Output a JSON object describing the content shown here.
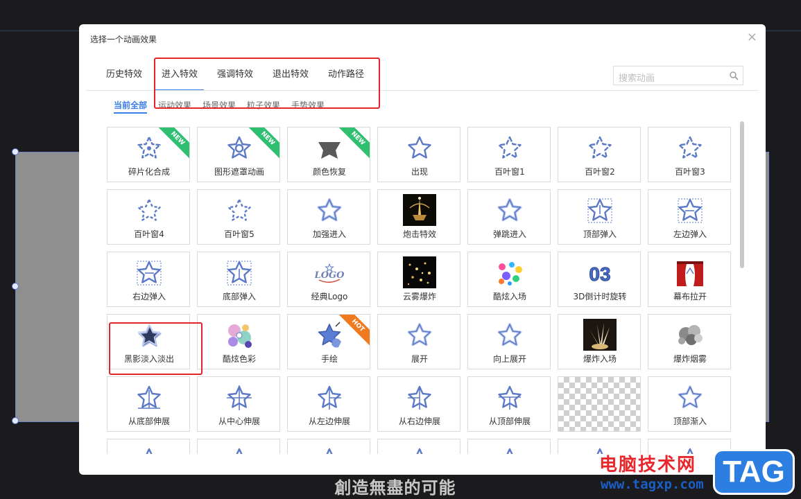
{
  "dialog": {
    "title": "选择一个动画效果",
    "close_label": "×",
    "search_placeholder": "搜索动画"
  },
  "tabs": [
    {
      "label": "历史特效",
      "active": false
    },
    {
      "label": "进入特效",
      "active": true
    },
    {
      "label": "强调特效",
      "active": false
    },
    {
      "label": "退出特效",
      "active": false
    },
    {
      "label": "动作路径",
      "active": false
    }
  ],
  "subtabs": [
    {
      "label": "当前全部",
      "active": true
    },
    {
      "label": "运动效果",
      "active": false
    },
    {
      "label": "场景效果",
      "active": false
    },
    {
      "label": "粒子效果",
      "active": false
    },
    {
      "label": "手势效果",
      "active": false
    }
  ],
  "effects": [
    {
      "label": "碎片化合成",
      "icon": "star-fragment-icon",
      "badge": "NEW"
    },
    {
      "label": "图形遮罩动画",
      "icon": "star-mask-icon",
      "badge": "NEW"
    },
    {
      "label": "颜色恢复",
      "icon": "star-color-icon",
      "badge": "NEW"
    },
    {
      "label": "出现",
      "icon": "star-icon",
      "badge": ""
    },
    {
      "label": "百叶窗1",
      "icon": "star-blinds-icon",
      "badge": ""
    },
    {
      "label": "百叶窗2",
      "icon": "star-blinds-icon",
      "badge": ""
    },
    {
      "label": "百叶窗3",
      "icon": "star-blinds-icon",
      "badge": ""
    },
    {
      "label": "百叶窗4",
      "icon": "star-dashed-icon",
      "badge": ""
    },
    {
      "label": "百叶窗5",
      "icon": "star-dashed-icon",
      "badge": ""
    },
    {
      "label": "加强进入",
      "icon": "star-double-icon",
      "badge": ""
    },
    {
      "label": "炮击特效",
      "icon": "fountain-thumb-icon",
      "badge": ""
    },
    {
      "label": "弹跳进入",
      "icon": "star-double-icon",
      "badge": ""
    },
    {
      "label": "顶部弹入",
      "icon": "star-arrow-down-icon",
      "badge": ""
    },
    {
      "label": "左边弹入",
      "icon": "star-arrow-right-icon",
      "badge": ""
    },
    {
      "label": "右边弹入",
      "icon": "star-arrow-left-icon",
      "badge": ""
    },
    {
      "label": "底部弹入",
      "icon": "star-arrow-up-icon",
      "badge": ""
    },
    {
      "label": "经典Logo",
      "icon": "logo-text-icon",
      "badge": ""
    },
    {
      "label": "云雾爆炸",
      "icon": "sparkle-thumb-icon",
      "badge": ""
    },
    {
      "label": "酷炫入场",
      "icon": "colorful-balls-icon",
      "badge": ""
    },
    {
      "label": "3D倒计时旋转",
      "icon": "3d-number-icon",
      "badge": ""
    },
    {
      "label": "幕布拉开",
      "icon": "curtain-icon",
      "badge": ""
    },
    {
      "label": "黑影淡入淡出",
      "icon": "star-shadow-icon",
      "badge": ""
    },
    {
      "label": "酷炫色彩",
      "icon": "color-blobs-icon",
      "badge": ""
    },
    {
      "label": "手绘",
      "icon": "hand-draw-icon",
      "badge": "HOT"
    },
    {
      "label": "展开",
      "icon": "star-expand-icon",
      "badge": ""
    },
    {
      "label": "向上展开",
      "icon": "star-expand-icon",
      "badge": ""
    },
    {
      "label": "爆炸入场",
      "icon": "explosion-thumb-icon",
      "badge": ""
    },
    {
      "label": "爆炸烟雾",
      "icon": "smoke-thumb-icon",
      "badge": ""
    },
    {
      "label": "从底部伸展",
      "icon": "star-stretch-up-icon",
      "badge": ""
    },
    {
      "label": "从中心伸展",
      "icon": "star-stretch-center-icon",
      "badge": ""
    },
    {
      "label": "从左边伸展",
      "icon": "star-stretch-right-icon",
      "badge": ""
    },
    {
      "label": "从右边伸展",
      "icon": "star-stretch-left-icon",
      "badge": ""
    },
    {
      "label": "从顶部伸展",
      "icon": "star-stretch-down-icon",
      "badge": ""
    },
    {
      "label": "",
      "icon": "transparent-placeholder-icon",
      "badge": ""
    },
    {
      "label": "顶部渐入",
      "icon": "star-fade-icon",
      "badge": ""
    }
  ],
  "background": {
    "slogan": "創造無盡的可能"
  },
  "watermark": {
    "site_name": "电脑技术网",
    "url": "www.tagxp.com",
    "logo": "TAG"
  },
  "colors": {
    "accent": "#3a7ee8",
    "star": "#5b79c6",
    "highlight": "#e4232a",
    "badge_new": "#2fbf71",
    "badge_hot": "#f07a1f"
  }
}
